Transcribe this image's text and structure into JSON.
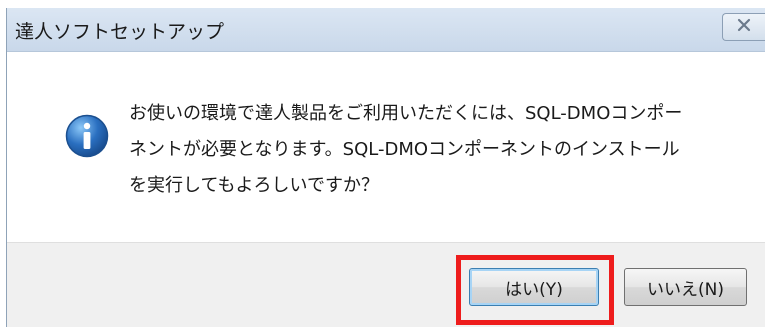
{
  "dialog": {
    "title": "達人ソフトセットアップ",
    "close_glyph": "☒",
    "icon": "information-icon",
    "message": "お使いの環境で達人製品をご利用いただくには、SQL-DMOコンポー\nネントが必要となります。SQL-DMOコンポーネントのインストール\nを実行してもよろしいですか？",
    "buttons": {
      "yes_label": "はい(Y)",
      "no_label": "いいえ(N)"
    }
  },
  "colors": {
    "highlight": "#ee1c1c",
    "info_icon_blue": "#2a6fc0",
    "titlebar": "#d3dfec"
  }
}
